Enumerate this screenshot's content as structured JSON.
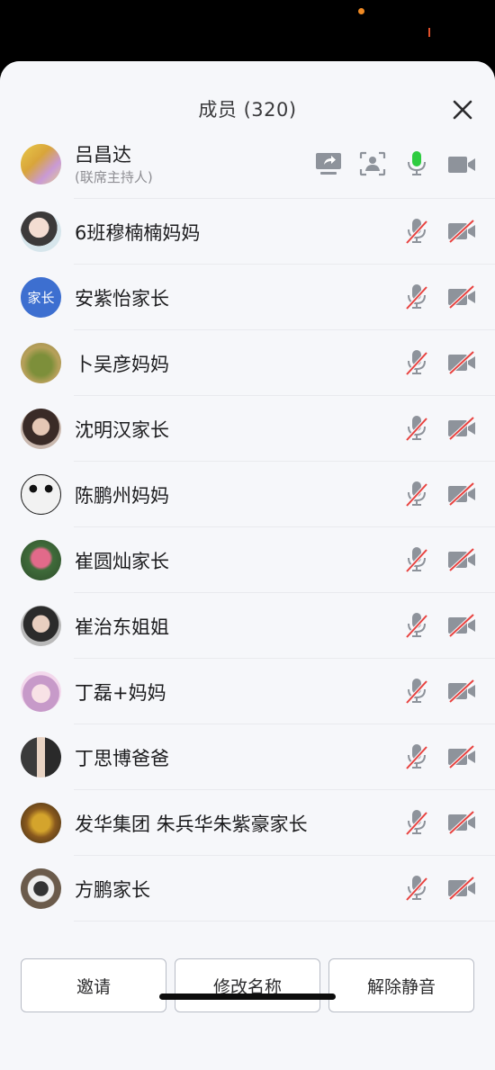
{
  "header": {
    "title": "成员 (320)"
  },
  "host": {
    "name": "吕昌达",
    "role": "(联席主持人)"
  },
  "members": [
    {
      "name": "6班穆楠楠妈妈"
    },
    {
      "name": "安紫怡家长",
      "avatar_text": "家长"
    },
    {
      "name": "卜吴彦妈妈"
    },
    {
      "name": "沈明汉家长"
    },
    {
      "name": "陈鹏州妈妈"
    },
    {
      "name": "崔圆灿家长"
    },
    {
      "name": "崔治东姐姐"
    },
    {
      "name": "丁磊+妈妈"
    },
    {
      "name": "丁思博爸爸"
    },
    {
      "name": "发华集团 朱兵华朱紫豪家长"
    },
    {
      "name": "方鹏家长"
    }
  ],
  "footer": {
    "invite": "邀请",
    "rename": "修改名称",
    "unmute": "解除静音"
  },
  "colors": {
    "mic_active": "#2ecc40",
    "muted_slash": "#e8423f",
    "icon_gray": "#8e939b"
  }
}
